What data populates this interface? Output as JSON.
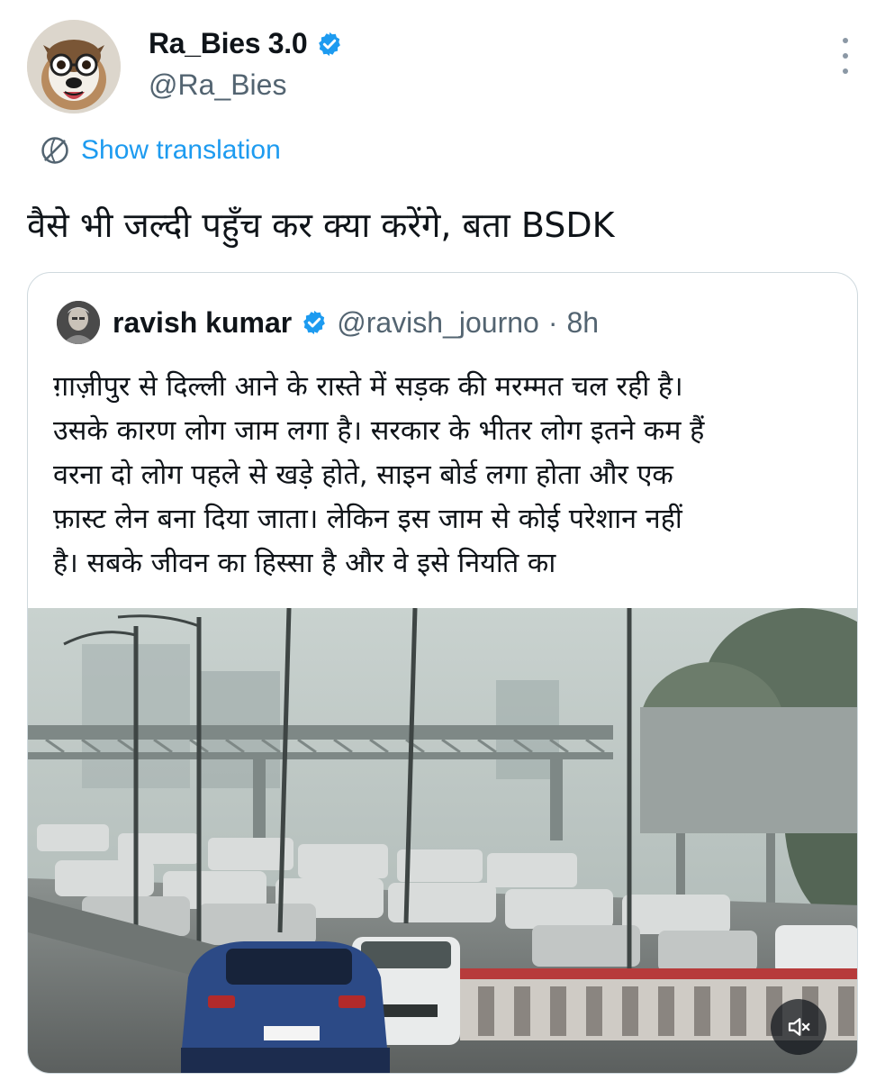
{
  "author": {
    "display_name": "Ra_Bies 3.0",
    "handle": "@Ra_Bies",
    "verified_icon": "verified-badge-icon",
    "avatar_icon": "dog-with-glasses-avatar"
  },
  "actions": {
    "more_icon": "more-vertical-icon"
  },
  "translation": {
    "label": "Show translation",
    "icon": "translate-globe-icon"
  },
  "tweet": {
    "text": "वैसे भी जल्दी पहुँच कर क्या करेंगे, बता BSDK"
  },
  "quoted": {
    "display_name": "ravish kumar",
    "handle": "@ravish_journo",
    "separator": "·",
    "time": "8h",
    "body_lines": [
      "ग़ाज़ीपुर से दिल्ली आने के रास्ते में सड़क की मरम्मत चल रही है।",
      "उसके कारण लोग जाम लगा है। सरकार के भीतर लोग इतने कम हैं",
      "वरना दो लोग पहले से खड़े होते, साइन बोर्ड लगा होता और एक",
      "फ़ास्ट लेन बना दिया जाता। लेकिन इस जाम से कोई परेशान नहीं",
      "है। सबके जीवन का हिस्सा है और वे इसे नियति का"
    ],
    "media": {
      "description_icon": "traffic-jam-video-thumbnail",
      "mute_icon": "speaker-muted-icon"
    }
  },
  "colors": {
    "accent": "#1d9bf0",
    "text": "#0f1419",
    "secondary": "#536471",
    "border": "#cfd9de"
  }
}
